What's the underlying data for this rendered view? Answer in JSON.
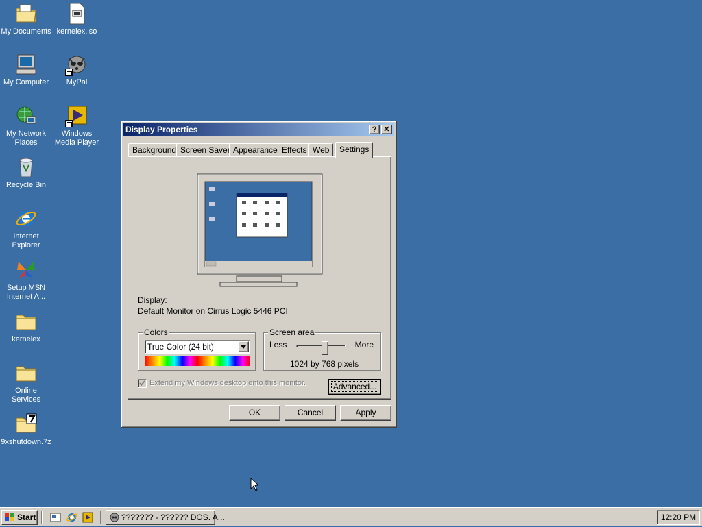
{
  "desktop": {
    "icons": [
      {
        "label": "My Documents"
      },
      {
        "label": "kernelex.iso"
      },
      {
        "label": "My Computer"
      },
      {
        "label": "MyPal"
      },
      {
        "label": "My Network Places"
      },
      {
        "label": "Windows Media Player"
      },
      {
        "label": "Recycle Bin"
      },
      {
        "label": "Internet Explorer"
      },
      {
        "label": "Setup MSN Internet A..."
      },
      {
        "label": "kernelex"
      },
      {
        "label": "Online Services"
      },
      {
        "label": "9xshutdown.7z"
      }
    ]
  },
  "dialog": {
    "title": "Display Properties",
    "help_label": "?",
    "close_label": "✕",
    "tabs": [
      "Background",
      "Screen Saver",
      "Appearance",
      "Effects",
      "Web",
      "Settings"
    ],
    "active_tab": "Settings",
    "display_label": "Display:",
    "display_value": "Default Monitor on Cirrus Logic 5446 PCI",
    "colors": {
      "legend": "Colors",
      "selected": "True Color (24 bit)"
    },
    "screen_area": {
      "legend": "Screen area",
      "less": "Less",
      "more": "More",
      "value_text": "1024 by 768 pixels",
      "slider_fraction": 0.6
    },
    "extend_label": "Extend my Windows desktop onto this monitor.",
    "extend_checked": true,
    "advanced_label": "Advanced...",
    "ok_label": "OK",
    "cancel_label": "Cancel",
    "apply_label": "Apply"
  },
  "taskbar": {
    "start_label": "Start",
    "task_label": "??????? - ?????? DOS. A...",
    "clock": "12:20 PM"
  },
  "colors": {
    "desktop": "#3a6ea5",
    "title_active_start": "#0a246a",
    "title_active_end": "#a6caf0",
    "face": "#d4d0c8"
  }
}
